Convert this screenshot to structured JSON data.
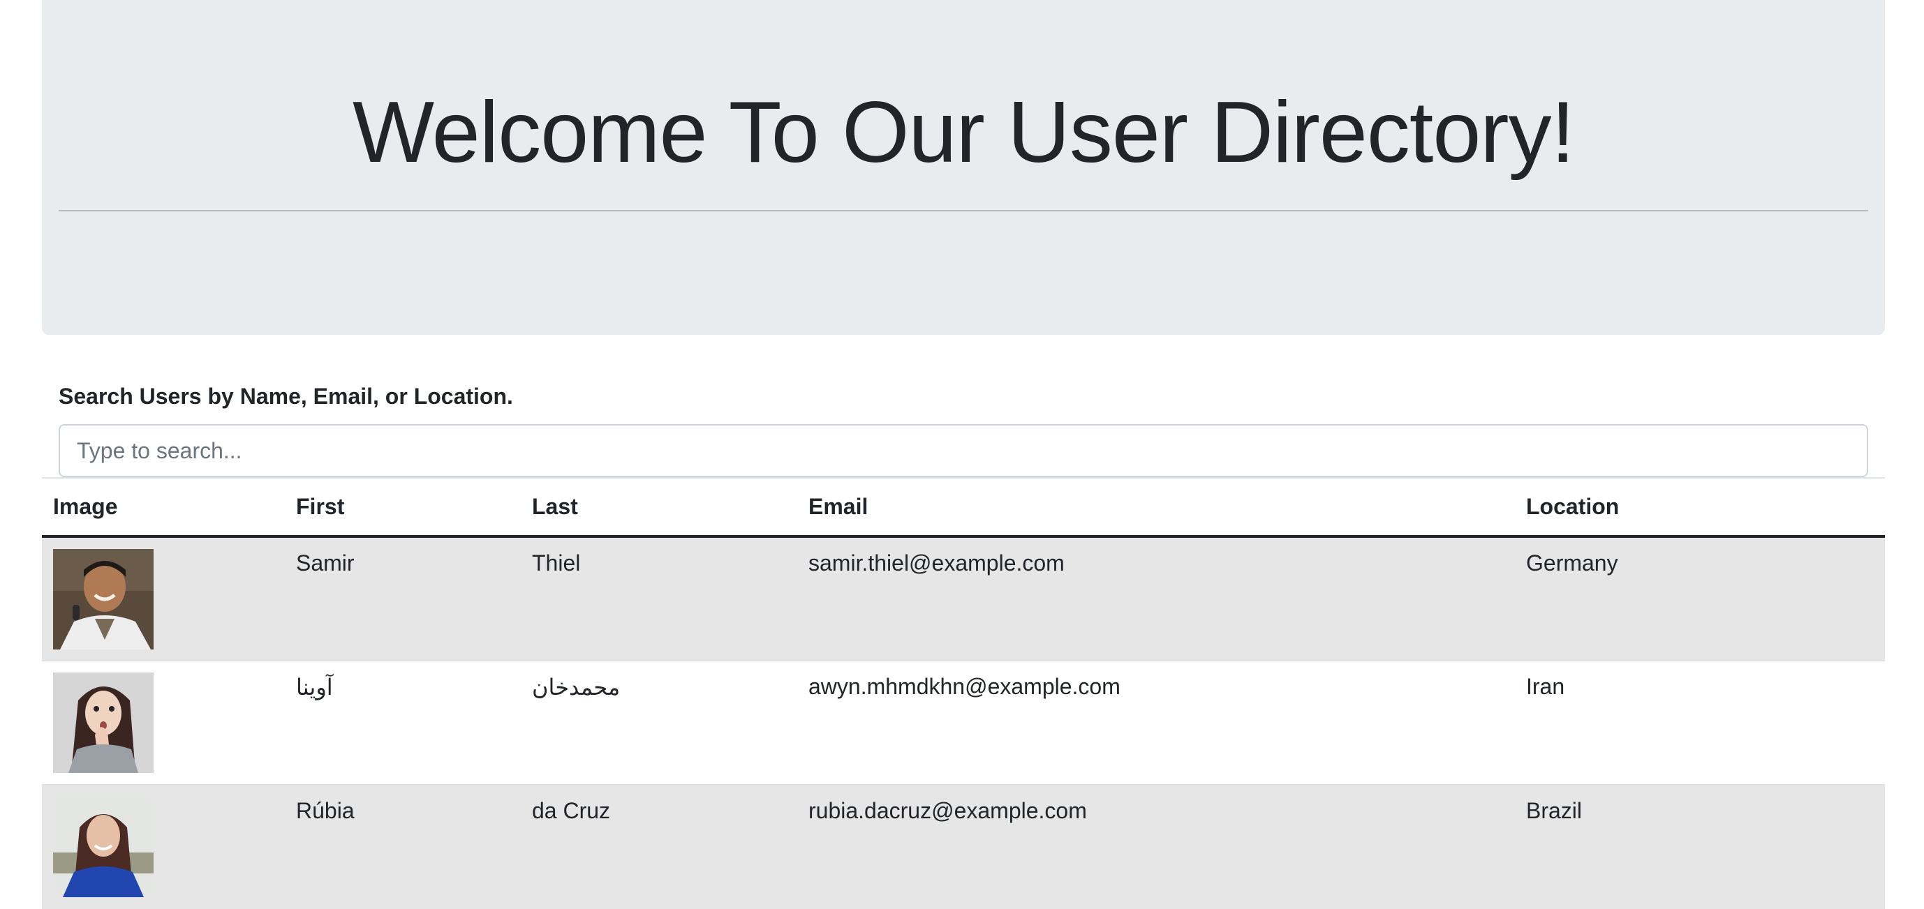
{
  "header": {
    "title": "Welcome To Our User Directory!"
  },
  "search": {
    "label": "Search Users by Name, Email, or Location.",
    "placeholder": "Type to search...",
    "value": ""
  },
  "table": {
    "columns": [
      "Image",
      "First",
      "Last",
      "Email",
      "Location"
    ],
    "rows": [
      {
        "image": "avatar-man-smiling",
        "first": "Samir",
        "last": "Thiel",
        "email": "samir.thiel@example.com",
        "location": "Germany"
      },
      {
        "image": "avatar-woman-surprised",
        "first": "آوینا",
        "last": "محمدخان",
        "email": "awyn.mhmdkhn@example.com",
        "location": "Iran"
      },
      {
        "image": "avatar-woman-blue-sweater",
        "first": "Rúbia",
        "last": "da Cruz",
        "email": "rubia.dacruz@example.com",
        "location": "Brazil"
      }
    ]
  },
  "colors": {
    "jumbotron_bg": "#e9ecef",
    "striped_row_bg": "#e6e6e6",
    "text": "#212529"
  }
}
